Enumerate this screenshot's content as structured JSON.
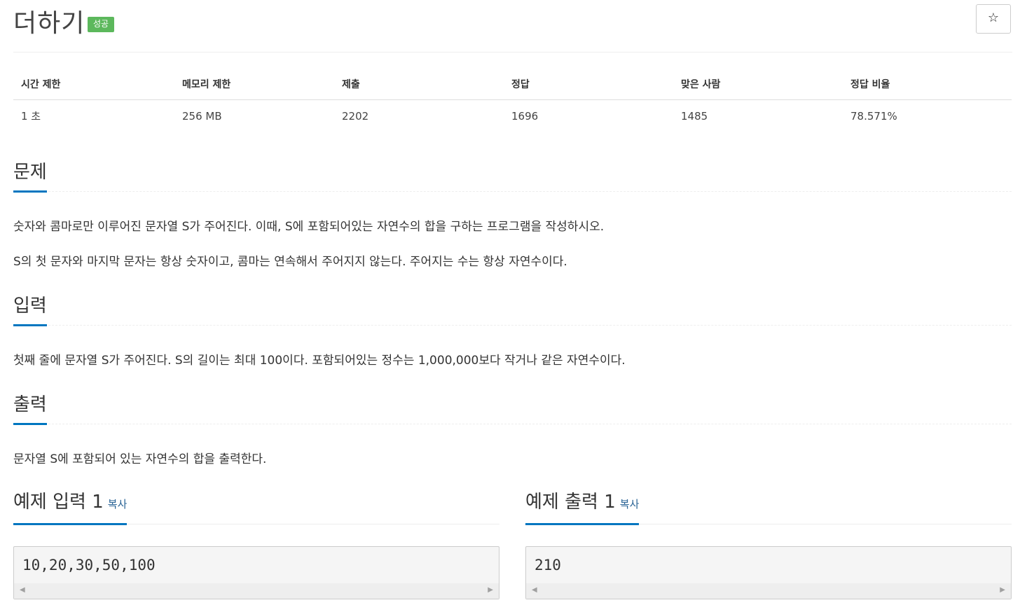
{
  "problem": {
    "title": "더하기",
    "badge": "성공",
    "star_icon": "☆"
  },
  "stats": {
    "headers": [
      "시간 제한",
      "메모리 제한",
      "제출",
      "정답",
      "맞은 사람",
      "정답 비율"
    ],
    "values": [
      "1 초",
      "256 MB",
      "2202",
      "1696",
      "1485",
      "78.571%"
    ]
  },
  "sections": {
    "description": {
      "title": "문제",
      "paragraphs": [
        "숫자와 콤마로만 이루어진 문자열 S가 주어진다. 이때, S에 포함되어있는 자연수의 합을 구하는 프로그램을 작성하시오.",
        "S의 첫 문자와 마지막 문자는 항상 숫자이고, 콤마는 연속해서 주어지지 않는다. 주어지는 수는 항상 자연수이다."
      ]
    },
    "input": {
      "title": "입력",
      "paragraphs": [
        "첫째 줄에 문자열 S가 주어진다. S의 길이는 최대 100이다. 포함되어있는 정수는 1,000,000보다 작거나 같은 자연수이다."
      ]
    },
    "output": {
      "title": "출력",
      "paragraphs": [
        "문자열 S에 포함되어 있는 자연수의 합을 출력한다."
      ]
    }
  },
  "samples": {
    "input": {
      "title": "예제 입력 1",
      "copy_label": "복사",
      "content": "10,20,30,50,100"
    },
    "output": {
      "title": "예제 출력 1",
      "copy_label": "복사",
      "content": "210"
    }
  },
  "colors": {
    "accent": "#0076c0",
    "badge_success": "#5cb85c",
    "link": "#2a6496"
  }
}
